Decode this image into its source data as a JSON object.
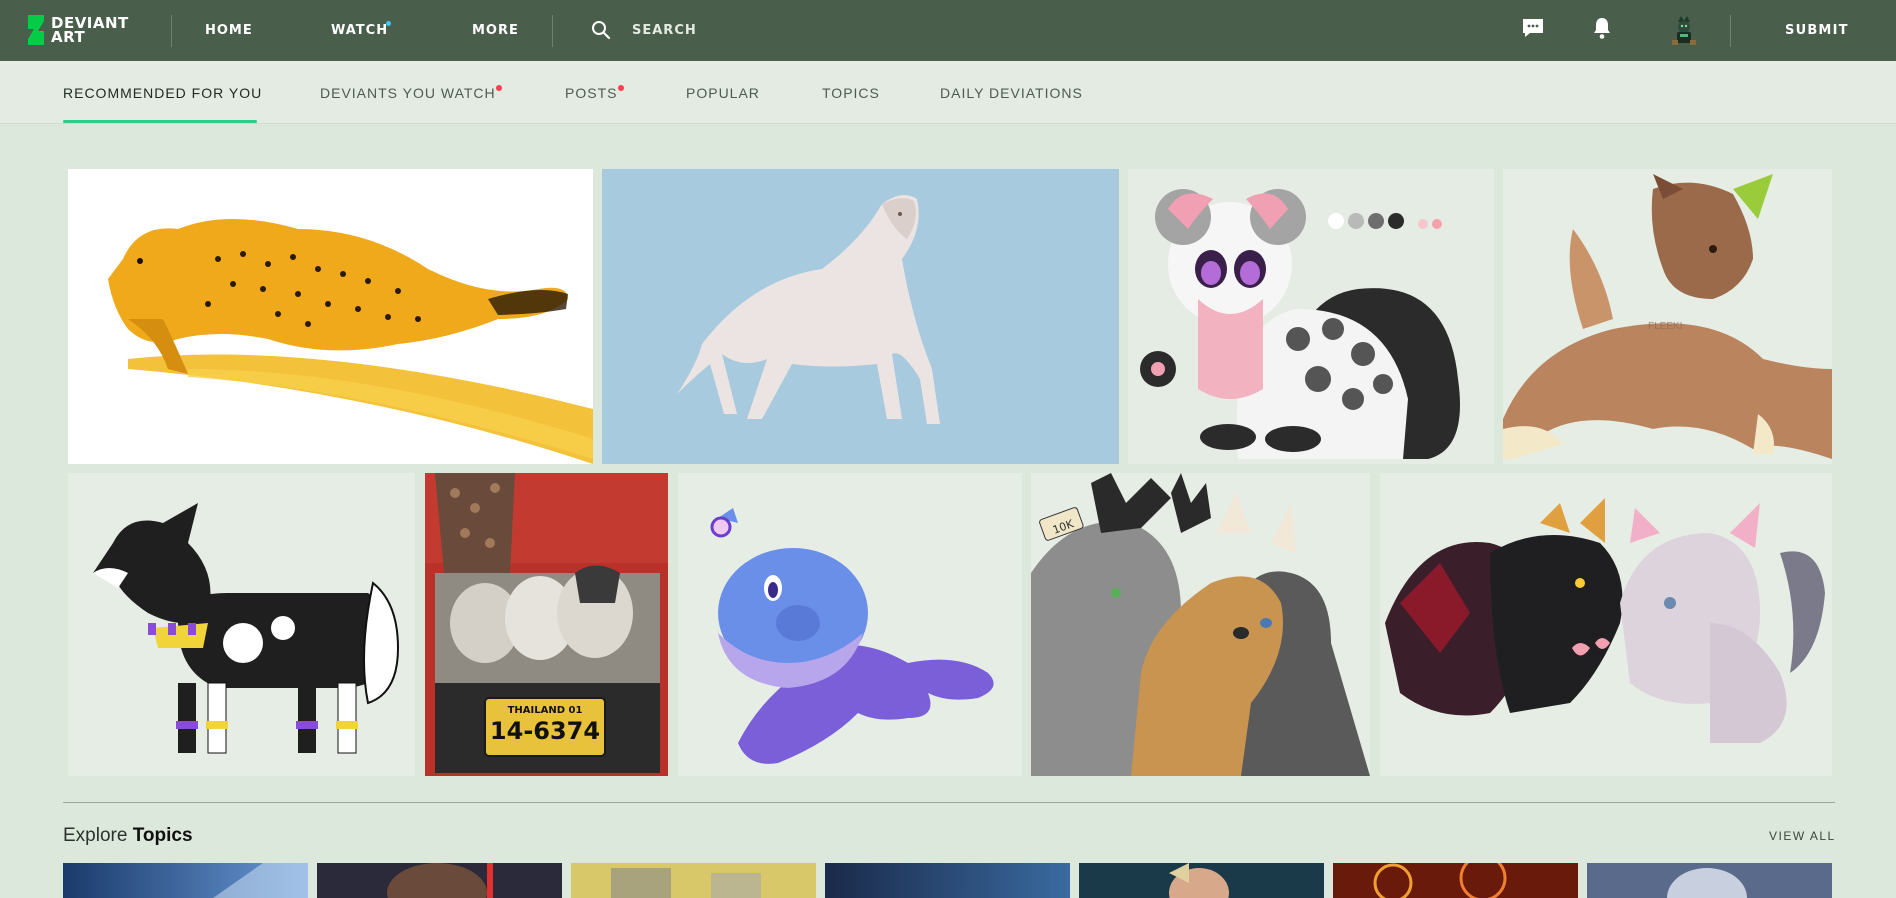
{
  "header": {
    "logo_line1": "DEVIANT",
    "logo_line2": "ART",
    "nav": [
      {
        "label": "HOME"
      },
      {
        "label": "WATCH"
      },
      {
        "label": "MORE"
      }
    ],
    "search_label": "SEARCH",
    "submit_label": "SUBMIT"
  },
  "tabs": [
    {
      "label": "RECOMMENDED FOR YOU"
    },
    {
      "label": "DEVIANTS YOU WATCH"
    },
    {
      "label": "POSTS"
    },
    {
      "label": "POPULAR"
    },
    {
      "label": "TOPICS"
    },
    {
      "label": "DAILY DEVIATIONS"
    }
  ],
  "gallery": {
    "watermarks": {
      "fox_text": "FLEEKI",
      "plate_top": "THAILAND 01",
      "plate_number": "14-6374",
      "tag_text": "10K"
    }
  },
  "explore": {
    "prefix": "Explore",
    "title": "Topics",
    "view_all": "VIEW ALL"
  },
  "colors": {
    "topbar": "#4a5e4c",
    "page_bg": "#dde8dc",
    "tab_accent": "#2fcc8b",
    "notification_dot_red": "#ff3d4e",
    "notification_dot_blue": "#3ec7ff"
  }
}
